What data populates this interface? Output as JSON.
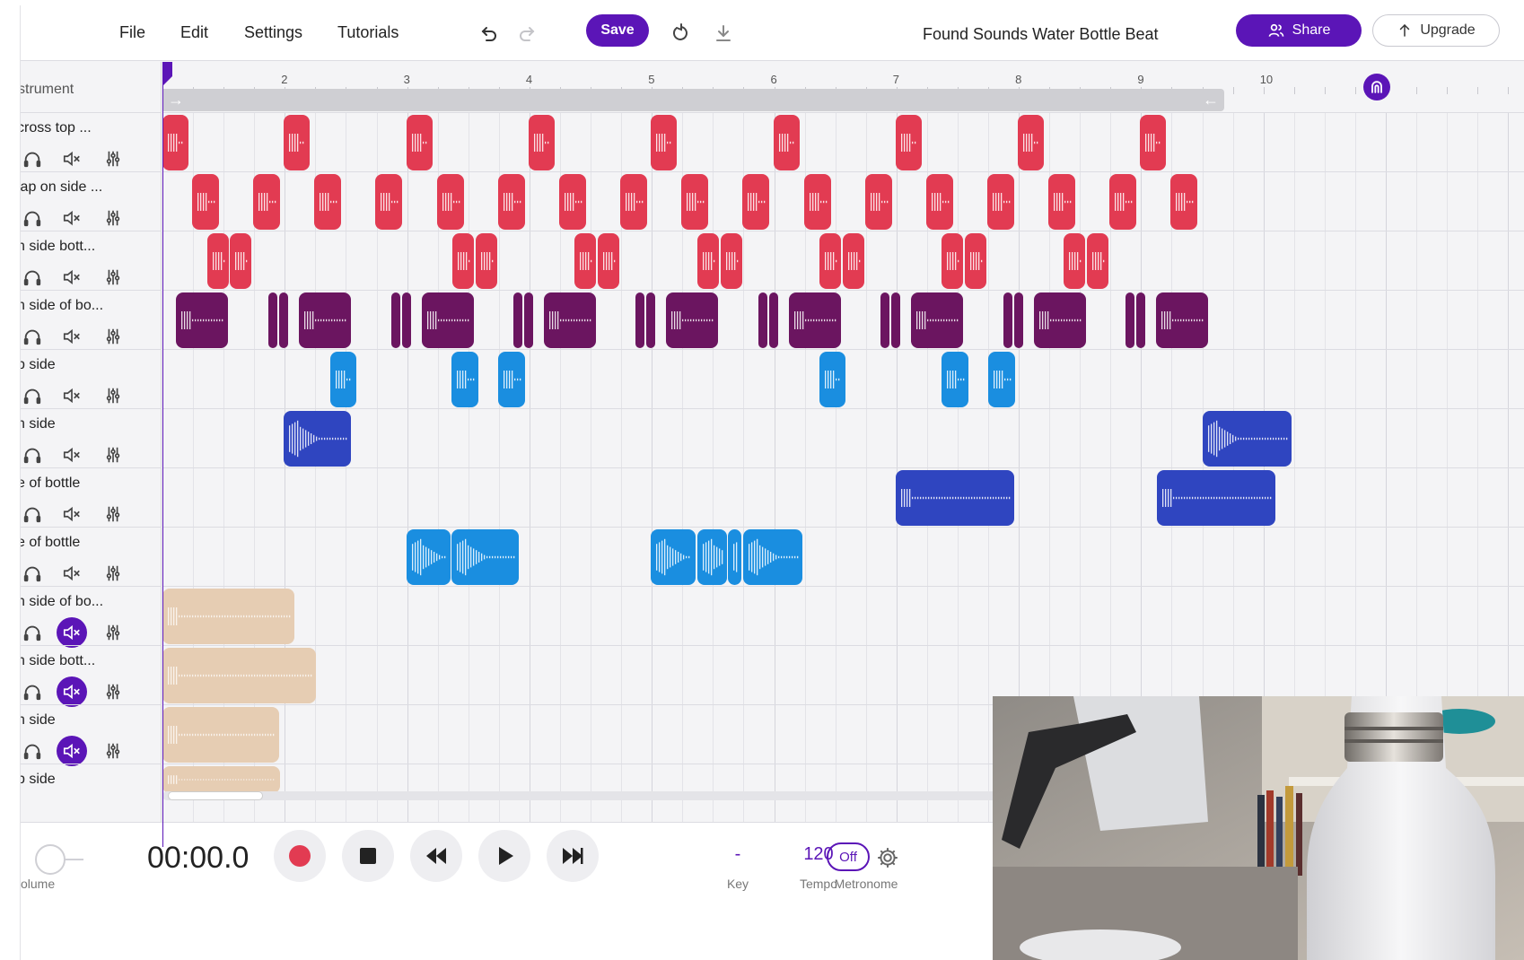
{
  "menu": {
    "file": "File",
    "edit": "Edit",
    "settings": "Settings",
    "tutorials": "Tutorials"
  },
  "toolbar": {
    "save": "Save",
    "title": "Found Sounds Water Bottle Beat",
    "share": "Share",
    "upgrade": "Upgrade"
  },
  "header": {
    "instrument_label": "strument"
  },
  "tracks": [
    {
      "name": "cross top ...",
      "muted": false,
      "color": "#e23b52"
    },
    {
      "name": "lap on side ...",
      "muted": false,
      "color": "#e23b52"
    },
    {
      "name": "n side bott...",
      "muted": false,
      "color": "#e23b52"
    },
    {
      "name": "n side of bo...",
      "muted": false,
      "color": "#6b1560"
    },
    {
      "name": "p side",
      "muted": false,
      "color": "#1a8ee0"
    },
    {
      "name": "n side",
      "muted": false,
      "color": "#2f45c0"
    },
    {
      "name": "e of bottle",
      "muted": false,
      "color": "#2f45c0"
    },
    {
      "name": "e of bottle",
      "muted": false,
      "color": "#1a8ee0"
    },
    {
      "name": "n side of bo...",
      "muted": true,
      "color": "#e6cdb3"
    },
    {
      "name": "n side bott...",
      "muted": true,
      "color": "#e6cdb3"
    },
    {
      "name": "n side",
      "muted": true,
      "color": "#e6cdb3"
    },
    {
      "name": "p side",
      "muted": true,
      "color": "#e6cdb3"
    }
  ],
  "ruler": {
    "bars": [
      "2",
      "3",
      "4",
      "5",
      "6",
      "7",
      "8",
      "9",
      "10"
    ]
  },
  "transport": {
    "volume_label": "olume",
    "time": "00:00.0",
    "key_value": "-",
    "key_label": "Key",
    "tempo_value": "120",
    "tempo_label": "Tempo",
    "metronome_value": "Off",
    "metronome_label": "Metronome"
  },
  "icons": {
    "undo": "undo-icon",
    "redo": "redo-icon",
    "loop": "loop-icon",
    "download": "download-icon",
    "share": "users-icon",
    "upgrade": "arrow-up-icon",
    "headphones": "headphones-icon",
    "mute": "speaker-mute-icon",
    "effects": "effects-icon",
    "record": "record-icon",
    "stop": "stop-icon",
    "rewind": "rewind-icon",
    "play": "play-icon",
    "fast-forward": "fast-forward-icon",
    "settings": "gear-icon"
  },
  "colors": {
    "accent": "#5b15b7",
    "red": "#e23b52",
    "plum": "#6b1560",
    "sky": "#1a8ee0",
    "royal": "#2f45c0",
    "muted_clip": "#e6cdb3"
  }
}
